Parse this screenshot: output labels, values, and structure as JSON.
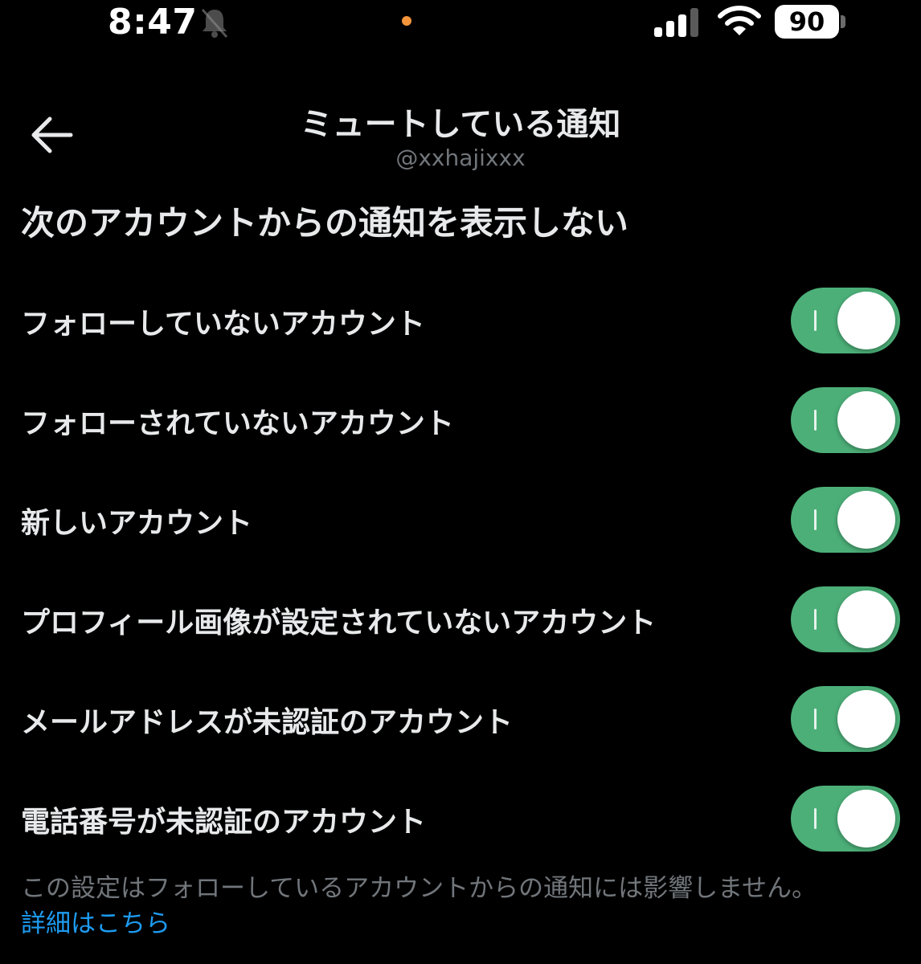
{
  "status_bar": {
    "time": "8:47",
    "battery": "90",
    "icons": [
      "bell-muted-icon",
      "signal-icon",
      "wifi-icon",
      "battery-icon"
    ],
    "indicator_color": "#f4943b"
  },
  "header": {
    "title": "ミュートしている通知",
    "subtitle": "@xxhajixxx",
    "back_icon": "back-arrow-icon"
  },
  "section": {
    "heading": "次のアカウントからの通知を表示しない"
  },
  "settings": [
    {
      "label": "フォローしていないアカウント",
      "enabled": true
    },
    {
      "label": "フォローされていないアカウント",
      "enabled": true
    },
    {
      "label": "新しいアカウント",
      "enabled": true
    },
    {
      "label": "プロフィール画像が設定されていないアカウント",
      "enabled": true
    },
    {
      "label": "メールアドレスが未認証のアカウント",
      "enabled": true
    },
    {
      "label": "電話番号が未認証のアカウント",
      "enabled": true
    }
  ],
  "footer": {
    "note": "この設定はフォローしているアカウントからの通知には影響しません。",
    "link": "詳細はこちら"
  },
  "colors": {
    "background": "#000000",
    "text": "#e7e9ea",
    "muted_text": "#71767b",
    "toggle_on": "#4caf78",
    "link": "#1d9bf0"
  }
}
